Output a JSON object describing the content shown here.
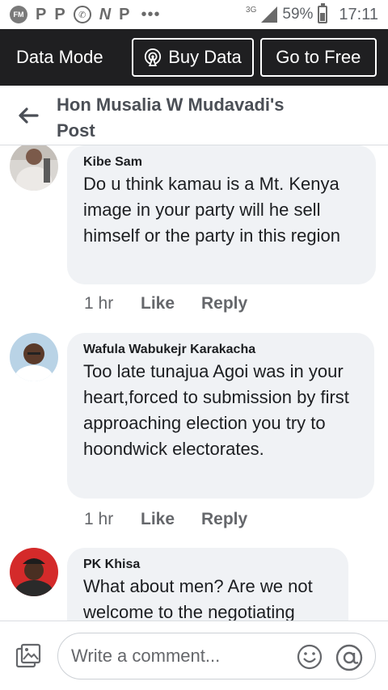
{
  "status_bar": {
    "fm": "FM",
    "app_icons": [
      "P",
      "P",
      "N",
      "P"
    ],
    "dots": "•••",
    "network": "3G",
    "battery": "59%",
    "time": "17:11"
  },
  "data_bar": {
    "mode_label": "Data Mode",
    "buy_label": "Buy Data",
    "free_label": "Go to Free"
  },
  "header": {
    "title": "Hon Musalia W Mudavadi's Post"
  },
  "comments": [
    {
      "name": "Kibe Sam",
      "text": "Do u think kamau is a Mt. Kenya  image in your party will he sell himself or the party in this region",
      "time": "1 hr",
      "like": "Like",
      "reply": "Reply"
    },
    {
      "name": "Wafula Wabukejr Karakacha",
      "text": "Too late tunajua Agoi was in your heart,forced to submission by first approaching election you try to hoondwick electorates.",
      "time": "1 hr",
      "like": "Like",
      "reply": "Reply"
    },
    {
      "name": "PK Khisa",
      "text": "What about men? Are we not welcome to the negotiating",
      "time": "",
      "like": "",
      "reply": ""
    }
  ],
  "composer": {
    "placeholder": "Write a comment..."
  },
  "colors": {
    "data_bar_bg": "#1f1f21",
    "bubble_bg": "#f0f2f5",
    "meta_text": "#65676b"
  }
}
